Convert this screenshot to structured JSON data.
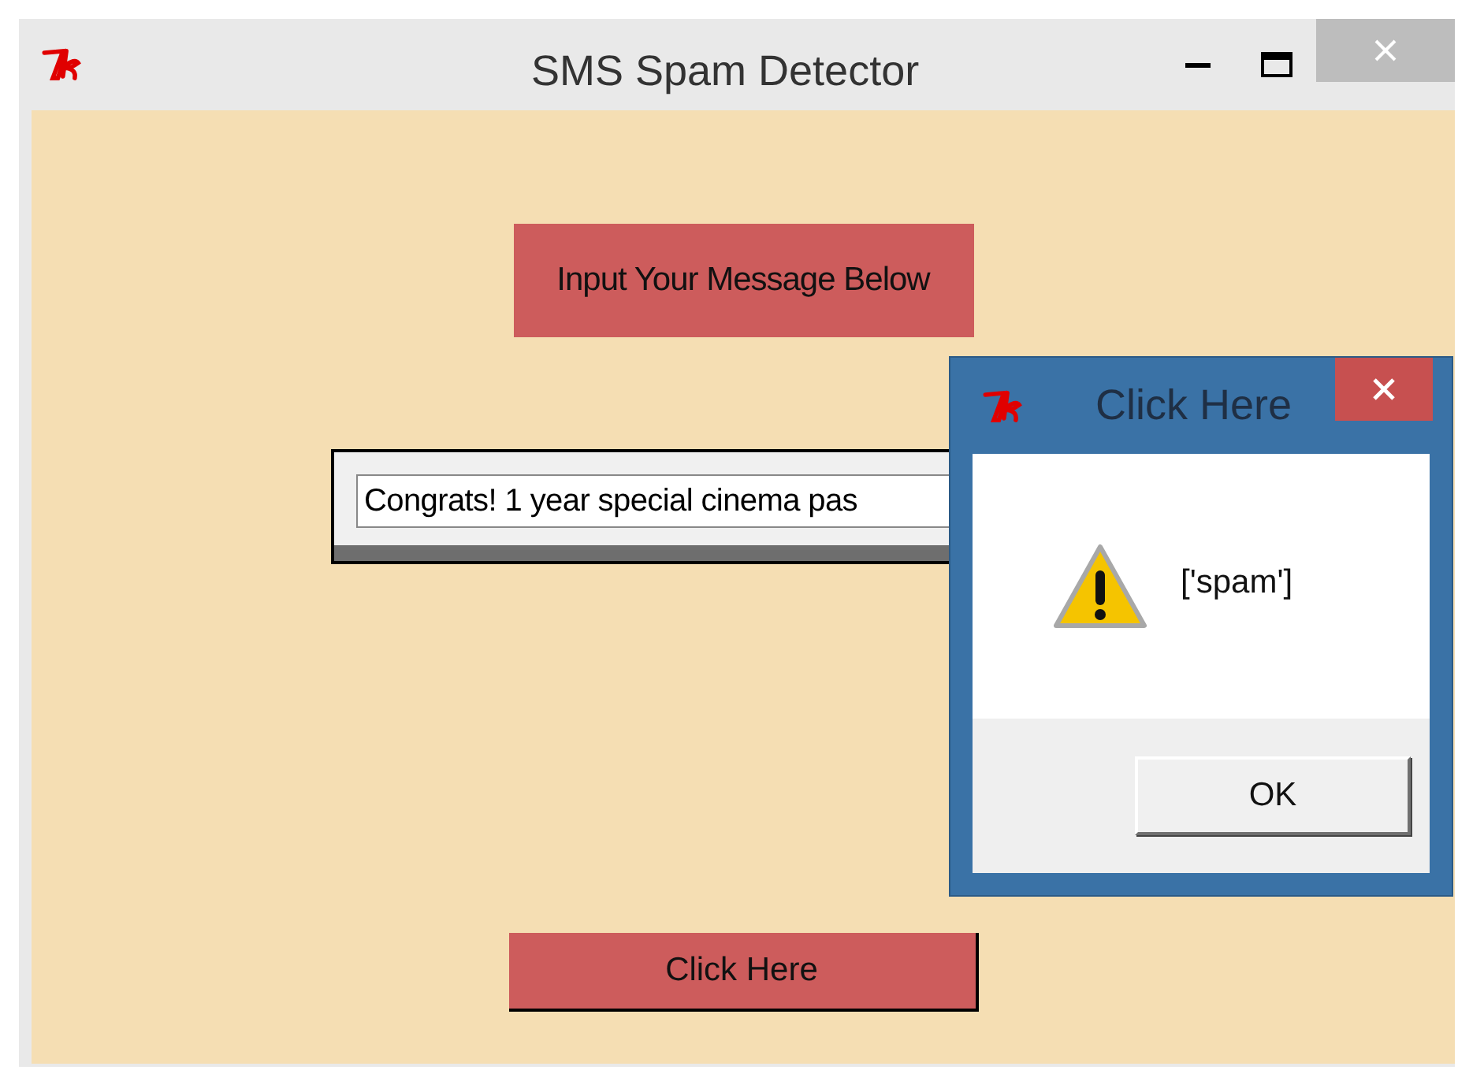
{
  "window": {
    "title": "SMS Spam Detector"
  },
  "heading_label": "Input Your Message Below",
  "message_field": {
    "value": "Congrats! 1 year special cinema pas"
  },
  "submit_button": "Click Here",
  "dialog": {
    "title": "Click Here",
    "message": "['spam']",
    "buttons": [
      "OK"
    ]
  }
}
